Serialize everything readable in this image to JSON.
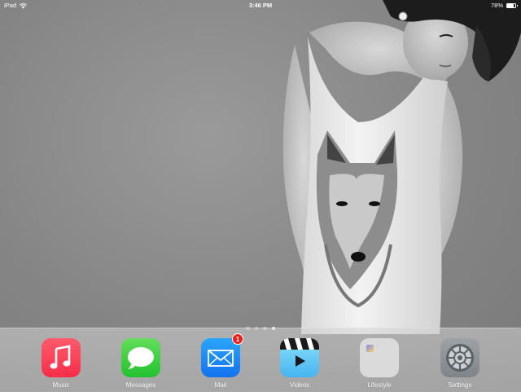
{
  "status_bar": {
    "device": "iPad",
    "time": "3:46 PM",
    "battery_percent": "78%",
    "battery_level": 0.78,
    "wifi_icon": "wifi-icon"
  },
  "page_indicator": {
    "total": 4,
    "active_index": 3
  },
  "dock": {
    "apps": [
      {
        "label": "Music",
        "icon": "music-note-icon",
        "color": "#f82d48"
      },
      {
        "label": "Messages",
        "icon": "speech-bubble-icon",
        "color": "#22c22f"
      },
      {
        "label": "Mail",
        "icon": "envelope-icon",
        "color": "#1472ee",
        "badge": "1"
      },
      {
        "label": "Videos",
        "icon": "clapperboard-icon",
        "color": "#46b3ef"
      },
      {
        "label": "Lifestyle",
        "icon": "folder-icon",
        "color": "#ebebeb"
      },
      {
        "label": "Settings",
        "icon": "gear-icon",
        "color": "#7e8489"
      }
    ]
  }
}
